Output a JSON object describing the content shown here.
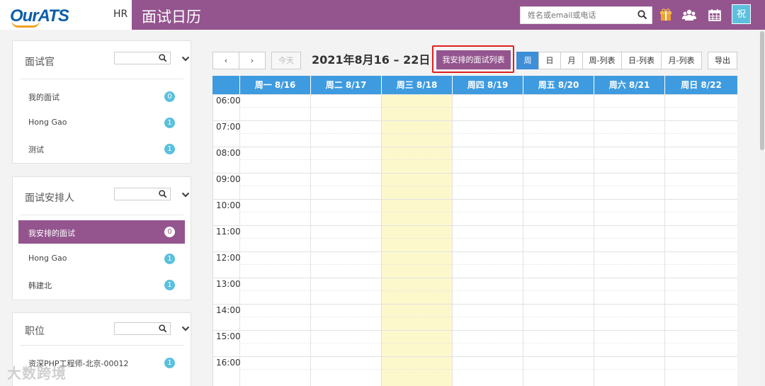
{
  "header": {
    "logo": "OurATS",
    "hr_label": "HR",
    "page_title": "面试日历",
    "search_placeholder": "姓名或email或电话",
    "wish_label": "祝"
  },
  "sidebar": {
    "interviewer": {
      "title": "面试官",
      "items": [
        {
          "label": "我的面试",
          "count": "0"
        },
        {
          "label": "Hong Gao",
          "count": "1"
        },
        {
          "label": "测试",
          "count": "1"
        }
      ]
    },
    "arranger": {
      "title": "面试安排人",
      "items": [
        {
          "label": "我安排的面试",
          "count": "0"
        },
        {
          "label": "Hong Gao",
          "count": "1"
        },
        {
          "label": "韩建北",
          "count": "1"
        }
      ]
    },
    "position": {
      "title": "职位",
      "items": [
        {
          "label": "资深PHP工程师-北京-00012",
          "count": "1"
        }
      ]
    }
  },
  "toolbar": {
    "prev": "‹",
    "next": "›",
    "today": "今天",
    "range_title": "2021年8月16 – 22日",
    "my_list": "我安排的面试列表",
    "views": [
      "周",
      "日",
      "月",
      "周-列表",
      "日-列表",
      "月-列表"
    ],
    "active_view": "周",
    "export": "导出"
  },
  "calendar": {
    "days": [
      "周一 8/16",
      "周二 8/17",
      "周三 8/18",
      "周四 8/19",
      "周五 8/20",
      "周六 8/21",
      "周日 8/22"
    ],
    "today_index": 2,
    "times": [
      "06:00",
      "07:00",
      "08:00",
      "09:00",
      "10:00",
      "11:00",
      "12:00",
      "13:00",
      "14:00",
      "15:00",
      "16:00"
    ]
  },
  "watermark": "大数跨境",
  "colors": {
    "brand_purple": "#94558f",
    "accent_blue": "#3e9be0",
    "badge_blue": "#5bc0de",
    "today_yellow": "#fcf8cb",
    "highlight_red": "#e02020"
  }
}
